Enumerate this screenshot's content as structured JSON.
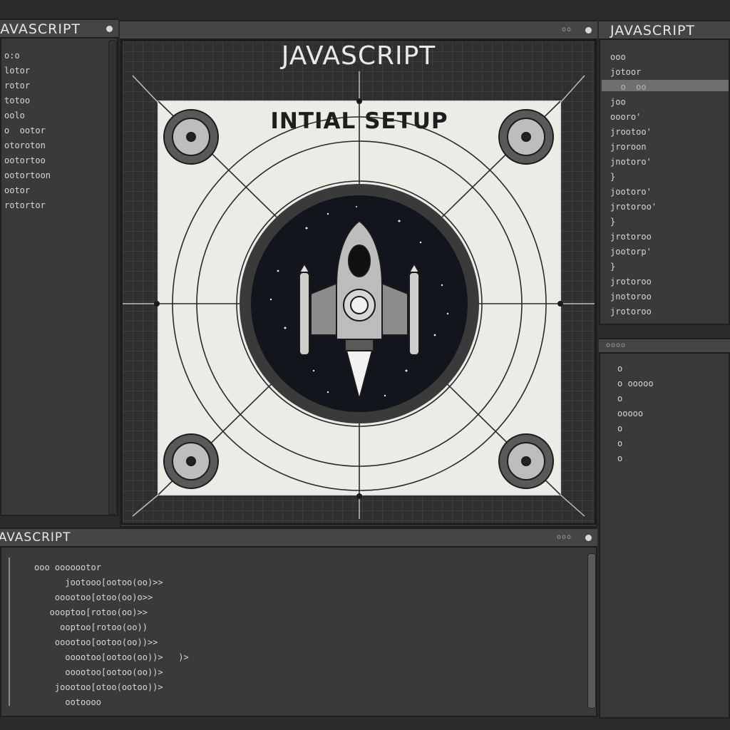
{
  "left_panel": {
    "title": "JAVASCRIPT",
    "lines": [
      "o:o",
      "lotor",
      "rotor",
      "totoo",
      "oolo",
      "o  ootor",
      "otoroton",
      "ootortoo",
      "ootortoon",
      "ootor",
      "rotortor"
    ]
  },
  "center_panel": {
    "header_dots": "oo",
    "main_title": "JAVASCRIPT",
    "card_title": "INTIAL SETUP"
  },
  "right_top_panel": {
    "title": "JAVASCRIPT",
    "lines": [
      "ooo",
      "jotoor",
      "  o  oo",
      "joo",
      "oooro'",
      "jrootoo'",
      "jroroon",
      "jnotoro'",
      "}",
      "jootoro'",
      "jrotoroo'",
      "}",
      "jrotoroo",
      "jootorp'",
      "}",
      "jrotoroo",
      "jnotoroo",
      "jrotoroo"
    ]
  },
  "right_bottom_panel": {
    "header": "oooo",
    "lines": [
      "o",
      "o ooooo",
      "o",
      "ooooo",
      "o",
      "o",
      "o"
    ]
  },
  "bottom_panel": {
    "title": "JAVASCRIPT",
    "header_dots": "ooo",
    "lines": [
      "ooo ooooootor",
      "      jootooo[ootoo(oo)>>",
      "    ooootoo[otoo(oo)o>>",
      "   oooptoo[rotoo(oo)>>",
      "     ooptoo[rotoo(oo))",
      "    ooootoo[ootoo(oo))>>",
      "      ooootoo[ootoo(oo))>   )>",
      "      ooootoo[ootoo(oo))>",
      "    joootoo[otoo(ootoo))>",
      "      ootoooo"
    ]
  },
  "colors": {
    "background": "#2b2b2b",
    "panel": "#3a3a3a",
    "card": "#ecebe6",
    "space": "#12151c",
    "ink": "#1e1e1e"
  },
  "icons": [
    "rocket-icon",
    "target-circle-icon"
  ]
}
